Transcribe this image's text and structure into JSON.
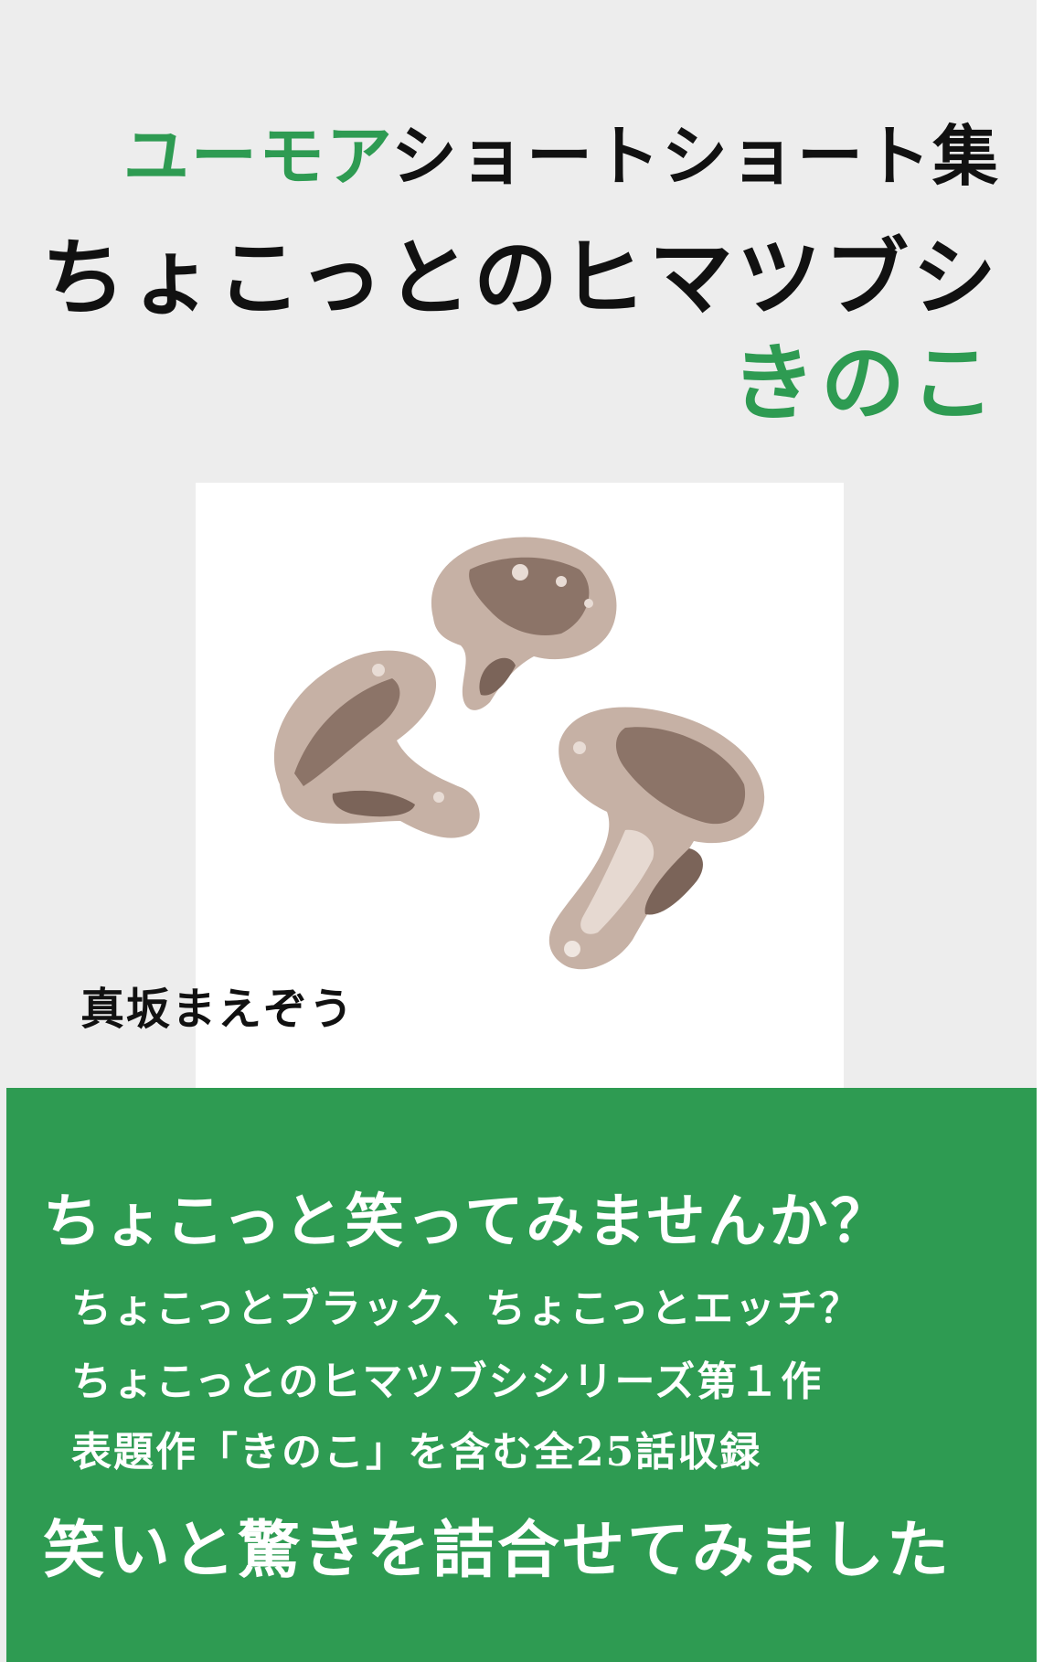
{
  "cover": {
    "series_prefix": "ユーモア",
    "series_suffix": "ショートショート集",
    "main_title": "ちょこっとのヒマツブシ",
    "sub_title": "きのこ",
    "author": "真坂まえぞう"
  },
  "blurb": {
    "headline": "ちょこっと笑ってみませんか？",
    "lines": [
      "ちょこっとブラック、ちょこっとエッチ？",
      "ちょこっとのヒマツブシシリーズ第１作",
      "表題作「きのこ」を含む全25話収録"
    ],
    "footer": "笑いと驚きを詰合せてみました"
  },
  "colors": {
    "background": "#ededed",
    "accent_green": "#2e9b52",
    "text_dark": "#111111",
    "mushroom_light": "#c6b1a5",
    "mushroom_dark": "#7b6459"
  },
  "illustration": {
    "subject": "mushrooms-illustration"
  }
}
